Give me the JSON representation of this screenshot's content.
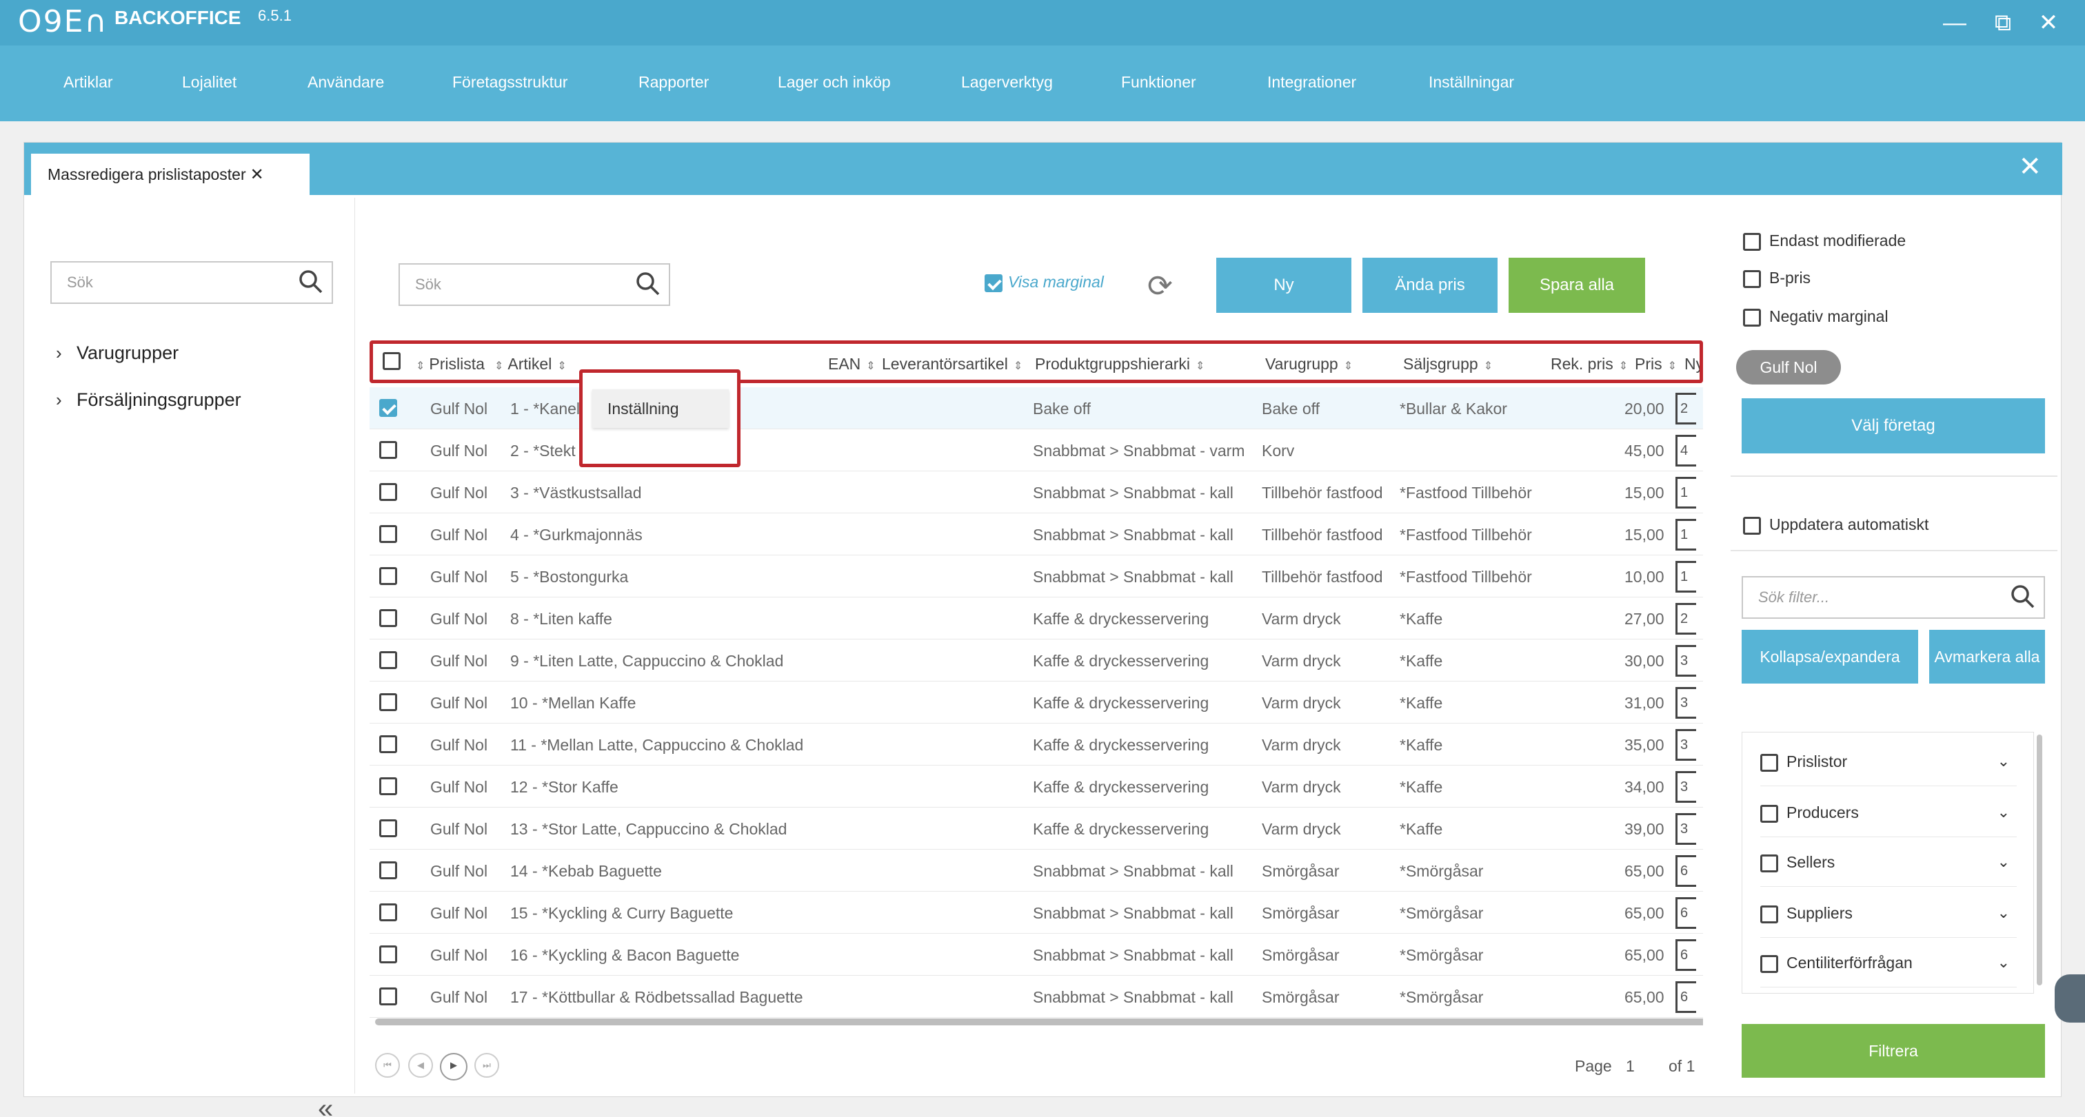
{
  "app": {
    "logo": "O9E∩",
    "title": "BACKOFFICE",
    "version": "6.5.1"
  },
  "window": {
    "minimize": "—",
    "restore": "⧉",
    "close": "✕"
  },
  "menu": [
    "Artiklar",
    "Lojalitet",
    "Användare",
    "Företagsstruktur",
    "Rapporter",
    "Lager och inköp",
    "Lagerverktyg",
    "Funktioner",
    "Integrationer",
    "Inställningar"
  ],
  "tab": {
    "label": "Massredigera prislistaposter",
    "close": "✕"
  },
  "panel_close": "✕",
  "left": {
    "search_placeholder": "Sök",
    "tree": [
      "Varugrupper",
      "Försäljningsgrupper"
    ],
    "collapse": "«"
  },
  "toolbar": {
    "search_placeholder": "Sök",
    "visa_marginal": "Visa marginal",
    "visa_marginal_checked": true,
    "buttons": {
      "ny": "Ny",
      "andra_pris": "Ända pris",
      "spara_alla": "Spara alla"
    }
  },
  "grid": {
    "headers": [
      "Prislista",
      "Artikel",
      "EAN",
      "Leverantörsartikel",
      "Produktgruppshierarki",
      "Varugrupp",
      "Säljsgrupp",
      "Rek. pris",
      "Pris",
      "Ny"
    ],
    "rows": [
      {
        "prislista": "Gulf Nol",
        "artikel": "1 - *Kanelbulle",
        "hierarki": "Bake off",
        "varugrupp": "Bake off",
        "saljgrupp": "*Bullar & Kakor",
        "pris": "20,00",
        "ny": "2",
        "checked": true
      },
      {
        "prislista": "Gulf Nol",
        "artikel": "2 - *Stekt korv",
        "hierarki": "Snabbmat > Snabbmat - varm",
        "varugrupp": "Korv",
        "saljgrupp": "",
        "pris": "45,00",
        "ny": "4",
        "checked": false
      },
      {
        "prislista": "Gulf Nol",
        "artikel": "3 - *Västkustsallad",
        "hierarki": "Snabbmat > Snabbmat - kall",
        "varugrupp": "Tillbehör fastfood",
        "saljgrupp": "*Fastfood Tillbehör",
        "pris": "15,00",
        "ny": "1",
        "checked": false
      },
      {
        "prislista": "Gulf Nol",
        "artikel": "4 - *Gurkmajonnäs",
        "hierarki": "Snabbmat > Snabbmat - kall",
        "varugrupp": "Tillbehör fastfood",
        "saljgrupp": "*Fastfood Tillbehör",
        "pris": "15,00",
        "ny": "1",
        "checked": false
      },
      {
        "prislista": "Gulf Nol",
        "artikel": "5 - *Bostongurka",
        "hierarki": "Snabbmat > Snabbmat - kall",
        "varugrupp": "Tillbehör fastfood",
        "saljgrupp": "*Fastfood Tillbehör",
        "pris": "10,00",
        "ny": "1",
        "checked": false
      },
      {
        "prislista": "Gulf Nol",
        "artikel": "8 - *Liten kaffe",
        "hierarki": "Kaffe & dryckesservering",
        "varugrupp": "Varm dryck",
        "saljgrupp": "*Kaffe",
        "pris": "27,00",
        "ny": "2",
        "checked": false
      },
      {
        "prislista": "Gulf Nol",
        "artikel": "9 - *Liten Latte, Cappuccino & Choklad",
        "hierarki": "Kaffe & dryckesservering",
        "varugrupp": "Varm dryck",
        "saljgrupp": "*Kaffe",
        "pris": "30,00",
        "ny": "3",
        "checked": false
      },
      {
        "prislista": "Gulf Nol",
        "artikel": "10 - *Mellan Kaffe",
        "hierarki": "Kaffe & dryckesservering",
        "varugrupp": "Varm dryck",
        "saljgrupp": "*Kaffe",
        "pris": "31,00",
        "ny": "3",
        "checked": false
      },
      {
        "prislista": "Gulf Nol",
        "artikel": "11 - *Mellan Latte, Cappuccino & Choklad",
        "hierarki": "Kaffe & dryckesservering",
        "varugrupp": "Varm dryck",
        "saljgrupp": "*Kaffe",
        "pris": "35,00",
        "ny": "3",
        "checked": false
      },
      {
        "prislista": "Gulf Nol",
        "artikel": "12 - *Stor Kaffe",
        "hierarki": "Kaffe & dryckesservering",
        "varugrupp": "Varm dryck",
        "saljgrupp": "*Kaffe",
        "pris": "34,00",
        "ny": "3",
        "checked": false
      },
      {
        "prislista": "Gulf Nol",
        "artikel": "13 - *Stor Latte, Cappuccino & Choklad",
        "hierarki": "Kaffe & dryckesservering",
        "varugrupp": "Varm dryck",
        "saljgrupp": "*Kaffe",
        "pris": "39,00",
        "ny": "3",
        "checked": false
      },
      {
        "prislista": "Gulf Nol",
        "artikel": "14 - *Kebab Baguette",
        "hierarki": "Snabbmat > Snabbmat - kall",
        "varugrupp": "Smörgåsar",
        "saljgrupp": "*Smörgåsar",
        "pris": "65,00",
        "ny": "6",
        "checked": false
      },
      {
        "prislista": "Gulf Nol",
        "artikel": "15 - *Kyckling & Curry Baguette",
        "hierarki": "Snabbmat > Snabbmat - kall",
        "varugrupp": "Smörgåsar",
        "saljgrupp": "*Smörgåsar",
        "pris": "65,00",
        "ny": "6",
        "checked": false
      },
      {
        "prislista": "Gulf Nol",
        "artikel": "16 - *Kyckling & Bacon Baguette",
        "hierarki": "Snabbmat > Snabbmat - kall",
        "varugrupp": "Smörgåsar",
        "saljgrupp": "*Smörgåsar",
        "pris": "65,00",
        "ny": "6",
        "checked": false
      },
      {
        "prislista": "Gulf Nol",
        "artikel": "17 - *Köttbullar & Rödbetssallad Baguette",
        "hierarki": "Snabbmat > Snabbmat - kall",
        "varugrupp": "Smörgåsar",
        "saljgrupp": "*Smörgåsar",
        "pris": "65,00",
        "ny": "6",
        "checked": false
      }
    ]
  },
  "popup": {
    "item": "Inställning"
  },
  "pager": {
    "page_label": "Page",
    "page": "1",
    "of_label": "of 1"
  },
  "right": {
    "options": [
      "Endast modifierade",
      "B-pris",
      "Negativ marginal"
    ],
    "chip": "Gulf Nol",
    "valj_foretag": "Välj företag",
    "uppdatera": "Uppdatera automatiskt",
    "filter_placeholder": "Sök filter...",
    "kollapsa": "Kollapsa/expandera",
    "avmarkera": "Avmarkera alla",
    "filters": [
      "Prislistor",
      "Producers",
      "Sellers",
      "Suppliers",
      "Centiliterförfrågan"
    ],
    "filtrera": "Filtrera"
  },
  "colors": {
    "accent": "#57b4d6",
    "green": "#7cba4e",
    "highlight": "#c0272d"
  }
}
